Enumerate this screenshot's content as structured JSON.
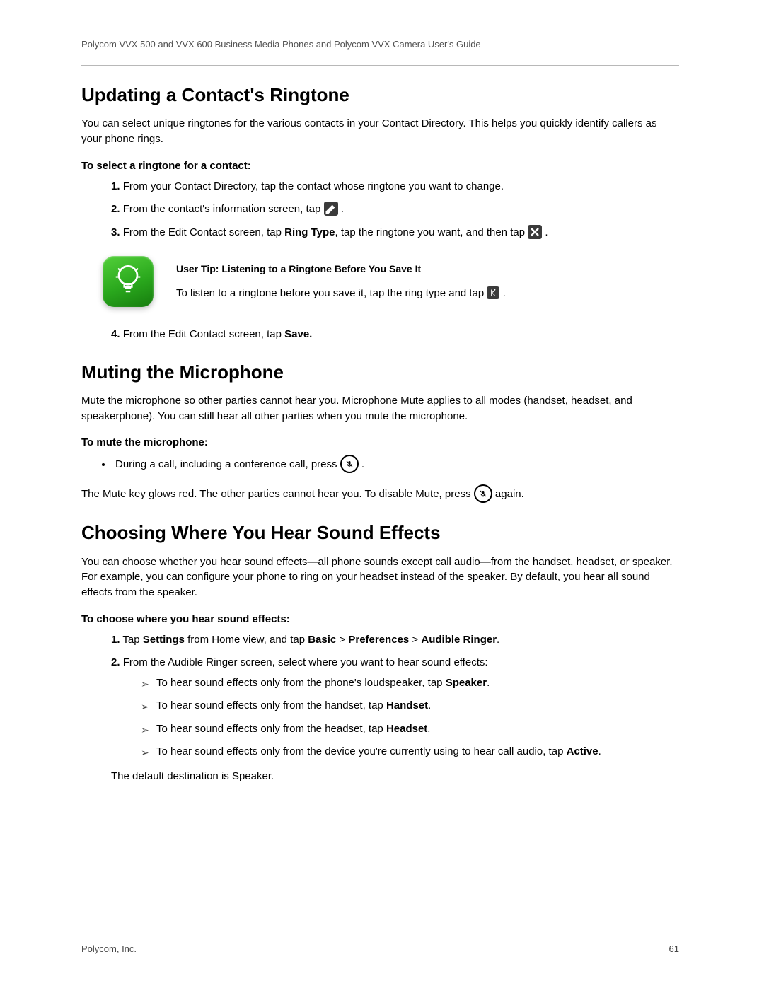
{
  "header": "Polycom VVX 500 and VVX 600 Business Media Phones and Polycom VVX Camera User's Guide",
  "section1": {
    "title": "Updating a Contact's Ringtone",
    "intro": "You can select unique ringtones for the various contacts in your Contact Directory. This helps you quickly identify callers as your phone rings.",
    "lead": "To select a ringtone for a contact:",
    "steps": {
      "s1_num": "1.",
      "s1": "From your Contact Directory, tap the contact whose ringtone you want to change.",
      "s2_num": "2.",
      "s2a": "From the contact's information screen, tap ",
      "s2b": " .",
      "s3_num": "3.",
      "s3a": "From the Edit Contact screen, tap ",
      "s3b": "Ring Type",
      "s3c": ", tap the ringtone you want, and then tap ",
      "s3d": " .",
      "s4_num": "4.",
      "s4a": "From the Edit Contact screen, tap ",
      "s4b": "Save."
    },
    "tip": {
      "title": "User Tip: Listening to a Ringtone Before You Save It",
      "body_a": "To listen to a ringtone before you save it, tap the ring type and tap ",
      "body_b": " ."
    }
  },
  "section2": {
    "title": "Muting the Microphone",
    "intro": "Mute the microphone so other parties cannot hear you. Microphone Mute applies to all modes (handset, headset, and speakerphone). You can still hear all other parties when you mute the microphone.",
    "lead": "To mute the microphone:",
    "bullet_a": "During a call, including a conference call, press ",
    "bullet_b": " .",
    "after_a": "The Mute key glows red. The other parties cannot hear you. To disable Mute, press ",
    "after_b": " again."
  },
  "section3": {
    "title": "Choosing Where You Hear Sound Effects",
    "intro": "You can choose whether you hear sound effects—all phone sounds except call audio—from the handset, headset, or speaker. For example, you can configure your phone to ring on your headset instead of the speaker. By default, you hear all sound effects from the speaker.",
    "lead": "To choose where you hear sound effects:",
    "s1_num": "1.",
    "s1_a": "Tap ",
    "s1_b": "Settings",
    "s1_c": " from Home view, and tap ",
    "s1_d": "Basic",
    "s1_e": " > ",
    "s1_f": "Preferences",
    "s1_g": " > ",
    "s1_h": "Audible Ringer",
    "s1_i": ".",
    "s2_num": "2.",
    "s2": "From the Audible Ringer screen, select where you want to hear sound effects:",
    "opts": {
      "o1a": "To hear sound effects only from the phone's loudspeaker, tap ",
      "o1b": "Speaker",
      "o1c": ".",
      "o2a": "To hear sound effects only from the handset, tap ",
      "o2b": "Handset",
      "o2c": ".",
      "o3a": "To hear sound effects only from the headset, tap ",
      "o3b": "Headset",
      "o3c": ".",
      "o4a": "To hear sound effects only from the device you're currently using to hear call audio, tap ",
      "o4b": "Active",
      "o4c": "."
    },
    "default": "The default destination is Speaker."
  },
  "footer": {
    "company": "Polycom, Inc.",
    "page": "61"
  }
}
